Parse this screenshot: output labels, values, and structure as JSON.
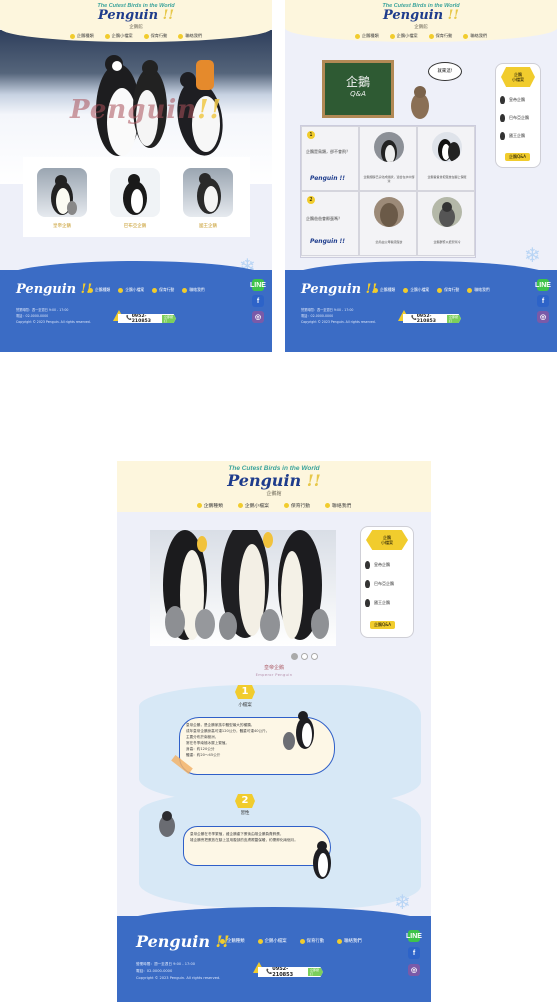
{
  "brand": {
    "tagline": "The Cutest Birds in the World",
    "logo_word": "Penguin",
    "logo_mark": "!!",
    "subtitle": "企鵝館"
  },
  "nav": [
    "企鵝種類",
    "企鵝小檔案",
    "保育行動",
    "聯絡我們"
  ],
  "hero": {
    "title_word": "Penguin",
    "title_mark": "!!"
  },
  "cards": [
    "皇帝企鵝",
    "巴布亞企鵝",
    "國王企鵝"
  ],
  "qa": {
    "board_title": "企鵝",
    "board_sub": "Q&A",
    "bubble": "就來這!",
    "cells": [
      {
        "num": "1",
        "text": "企鵝是鳥類，卻不會飛？",
        "sign": "Penguin !!"
      },
      {
        "num": "2",
        "text": "企鵝爸爸會孵蛋嗎？",
        "sign": "Penguin !!"
      }
    ],
    "captions": [
      "企鵝翅膀已演化成鰭狀，適合在水中游泳",
      "企鵝爸爸會把蛋放在腳上保暖",
      "幼鳥由父母輪流餵食",
      "企鵝群聚以抵禦寒冷"
    ]
  },
  "sidebar": {
    "title_line1": "企鵝",
    "title_line2": "小檔案",
    "items": [
      "皇帝企鵝",
      "巴布亞企鵝",
      "國王企鵝"
    ],
    "button": "企鵝Q&A"
  },
  "detail": {
    "section_title": "皇帝企鵝",
    "section_sub": "Emperor Penguin",
    "block1": {
      "num": "1",
      "title": "小檔案",
      "lines": [
        "皇帝企鵝，是企鵝家族中體型最大的種類。",
        "成年皇帝企鵝身高可達120公分，體重可達40公斤。",
        "主要分布於南極洲，",
        "常在冬季南極冰層上繁殖。",
        "身高：約120公分",
        "體重：約20～45公斤"
      ]
    },
    "block2": {
      "num": "2",
      "title": "習性",
      "lines": [
        "皇帝企鵝在冬季繁殖，雌企鵝產下蛋後由雄企鵝負責孵蛋，",
        "雄企鵝會把蛋放在腳上並用腹部的皮膚覆蓋保暖，約需孵化兩個月。"
      ]
    }
  },
  "footer": {
    "logo_word": "Penguin",
    "logo_mark": "!!",
    "nav": [
      "企鵝種類",
      "企鵝小檔案",
      "保育行動",
      "聯絡我們"
    ],
    "info": [
      "營業時間：週一至週日 9:00 - 17:00",
      "電話：02-0000-0000",
      "Copyright © 2023 Penguin. All rights reserved."
    ],
    "phone": "0952-210853",
    "phone_tag": "立即撥打",
    "page_top": "PAGE TOP",
    "social": [
      "LINE",
      "f",
      "◎"
    ],
    "social_colors": [
      "#3ec34a",
      "#2d63c8",
      "#7a5aa8"
    ]
  },
  "colors": {
    "accent": "#f1cc2d",
    "footer": "#3b6cc5",
    "header": "#fdf6dd",
    "logo": "#1e3c8c"
  }
}
